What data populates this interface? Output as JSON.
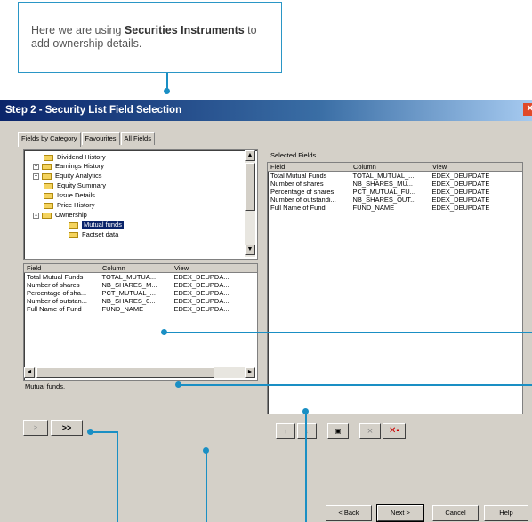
{
  "callout": {
    "text_pre": "Here we are using ",
    "text_bold": "Securities Instruments",
    "text_post": " to add ownership details."
  },
  "window": {
    "title": "Step 2 -  Security List Field Selection"
  },
  "tabs": [
    "Fields by Category",
    "Favourites",
    "All Fields"
  ],
  "tree": {
    "items": [
      {
        "label": "Dividend History",
        "expander": ""
      },
      {
        "label": "Earnings History",
        "expander": "+"
      },
      {
        "label": "Equity Analytics",
        "expander": "+"
      },
      {
        "label": "Equity Summary",
        "expander": ""
      },
      {
        "label": "Issue Details",
        "expander": ""
      },
      {
        "label": "Price History",
        "expander": ""
      },
      {
        "label": "Ownership",
        "expander": "−"
      },
      {
        "label": "Mutual funds",
        "expander": ""
      },
      {
        "label": "Factset data",
        "expander": ""
      }
    ]
  },
  "left_table": {
    "headers": [
      "Field",
      "Column",
      "View"
    ],
    "rows": [
      [
        "Total Mutual Funds",
        "TOTAL_MUTUA...",
        "EDEX_DEUPDA..."
      ],
      [
        "Number of shares",
        "NB_SHARES_M...",
        "EDEX_DEUPDA..."
      ],
      [
        "Percentage of sha...",
        "PCT_MUTUAL_...",
        "EDEX_DEUPDA..."
      ],
      [
        "Number of outstan...",
        "NB_SHARES_0...",
        "EDEX_DEUPDA..."
      ],
      [
        "Full Name of Fund",
        "FUND_NAME",
        "EDEX_DEUPDA..."
      ]
    ]
  },
  "description": "Mutual funds.",
  "selected": {
    "label": "Selected Fields",
    "headers": [
      "Field",
      "Column",
      "View"
    ],
    "rows": [
      [
        "Total Mutual Funds",
        "TOTAL_MUTUAL_...",
        "EDEX_DEUPDATE"
      ],
      [
        "Number of shares",
        "NB_SHARES_MU...",
        "EDEX_DEUPDATE"
      ],
      [
        "Percentage of shares",
        "PCT_MUTUAL_FU...",
        "EDEX_DEUPDATE"
      ],
      [
        "Number of outstandi...",
        "NB_SHARES_OUT...",
        "EDEX_DEUPDATE"
      ],
      [
        "Full Name of Fund",
        "FUND_NAME",
        "EDEX_DEUPDATE"
      ]
    ]
  },
  "buttons": {
    "add": ">",
    "add_all": ">>",
    "up": "↑",
    "down": "↓",
    "delete": "×",
    "back": "< Back",
    "next": "Next >",
    "cancel": "Cancel",
    "help": "Help"
  },
  "colors": {
    "accent": "#1a8fc4",
    "titlebar": "#0a246a"
  }
}
